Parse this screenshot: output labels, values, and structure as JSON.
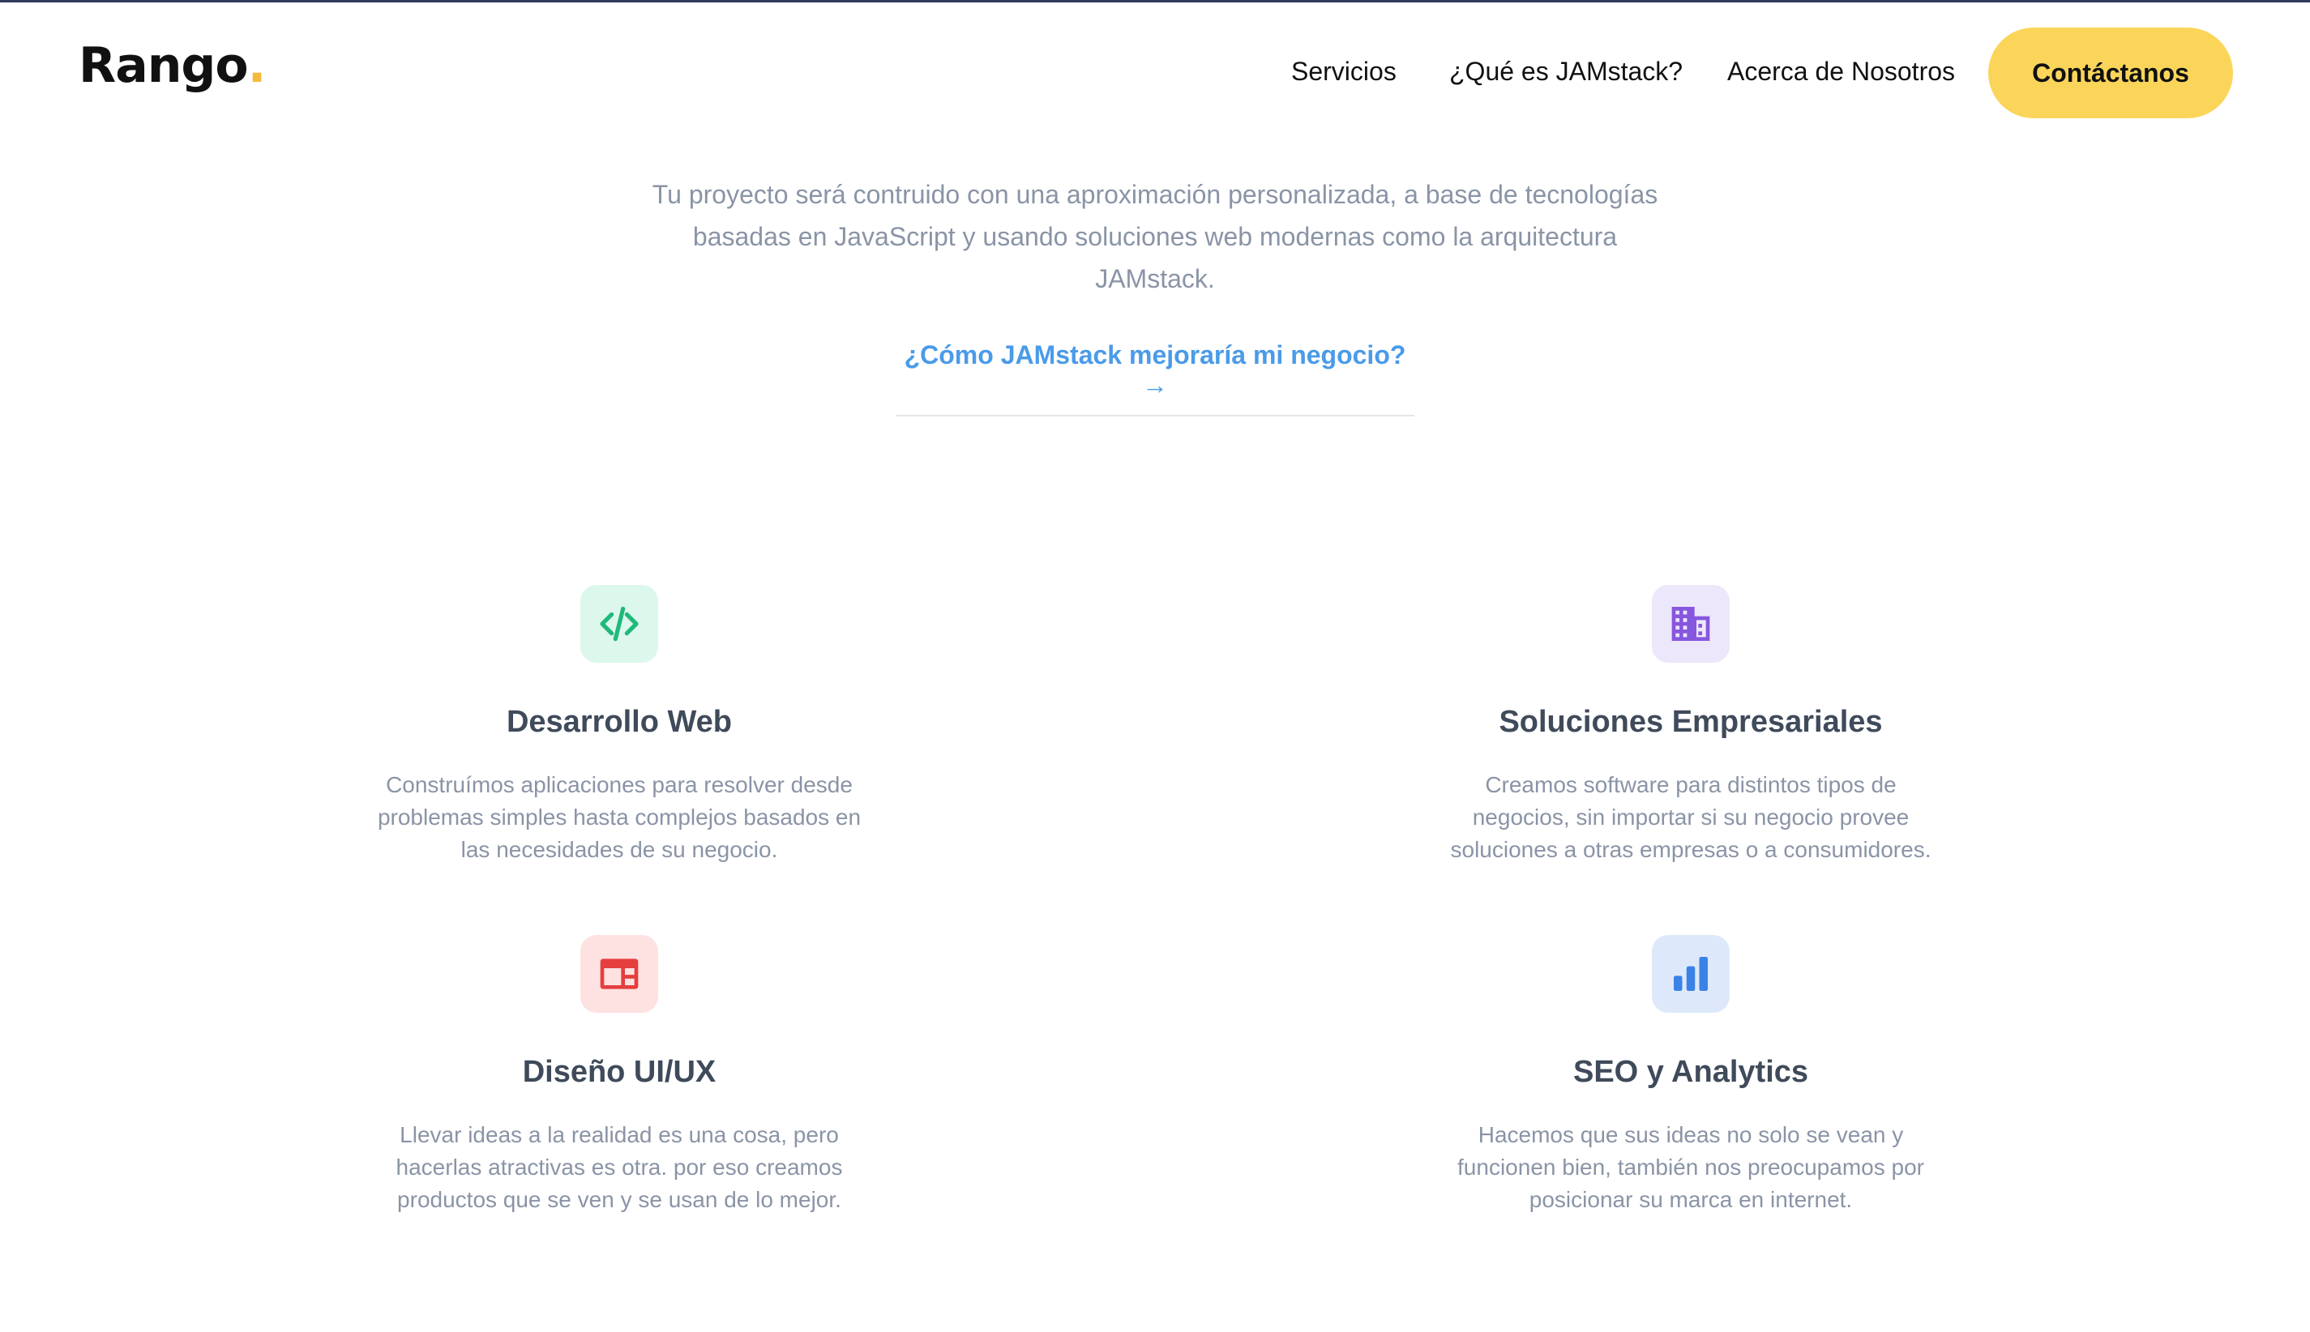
{
  "brand": {
    "name": "Rango",
    "dot": ".",
    "accent": "#f6b93b"
  },
  "nav": {
    "items": [
      {
        "label": "Servicios"
      },
      {
        "label": "¿Qué es JAMstack?"
      },
      {
        "label": "Acerca de Nosotros"
      }
    ],
    "cta_label": "Contáctanos",
    "cta_color": "#fbd55a"
  },
  "intro": {
    "text": "Tu proyecto será contruido con una aproximación personalizada, a base de tecnologías basadas en JavaScript y usando soluciones web modernas como la arquitectura JAMstack.",
    "link": "¿Cómo JAMstack mejoraría mi negocio? →",
    "link_color": "#4a9be8"
  },
  "services": [
    {
      "icon": "code-icon",
      "title": "Desarrollo Web",
      "description": "Construímos aplicaciones para resolver desde problemas simples hasta complejos basados en las necesidades de su negocio.",
      "icon_bg": "#dcf7ec",
      "icon_color": "#1fb97a"
    },
    {
      "icon": "building-icon",
      "title": "Soluciones Empresariales",
      "description": "Creamos software para distintos tipos de negocios, sin importar si su negocio provee soluciones a otras empresas o a consumidores.",
      "icon_bg": "#ede7fb",
      "icon_color": "#8757dd"
    },
    {
      "icon": "browser-window-icon",
      "title": "Diseño UI/UX",
      "description": "Llevar ideas a la realidad es una cosa, pero hacerlas atractivas es otra. por eso creamos productos que se ven y se usan de lo mejor.",
      "icon_bg": "#fde2e1",
      "icon_color": "#e53e3e"
    },
    {
      "icon": "bar-chart-icon",
      "title": "SEO y Analytics",
      "description": "Hacemos que sus ideas no solo se vean y funcionen bien, también nos preocupamos por posicionar su marca en internet.",
      "icon_bg": "#dde9fb",
      "icon_color": "#3b82e6"
    }
  ]
}
